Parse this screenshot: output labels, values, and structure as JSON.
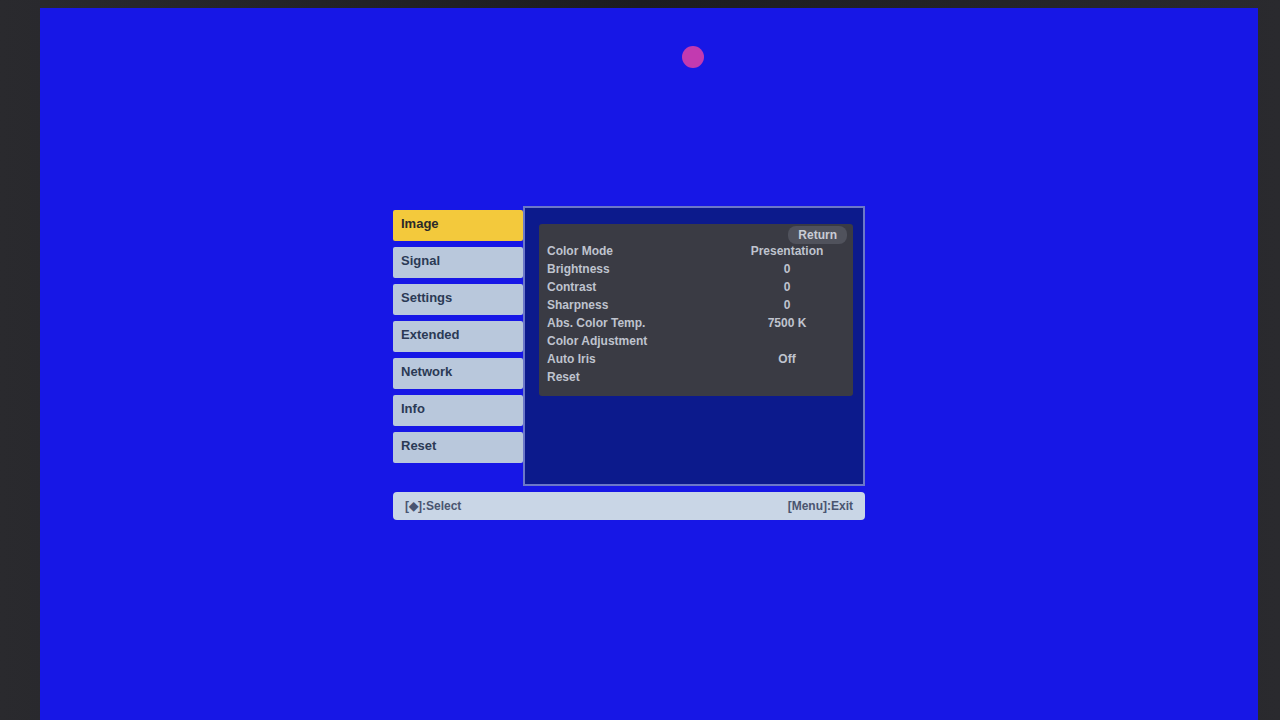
{
  "menu": {
    "tabs": [
      {
        "label": "Image",
        "selected": true
      },
      {
        "label": "Signal",
        "selected": false
      },
      {
        "label": "Settings",
        "selected": false
      },
      {
        "label": "Extended",
        "selected": false
      },
      {
        "label": "Network",
        "selected": false
      },
      {
        "label": "Info",
        "selected": false
      },
      {
        "label": "Reset",
        "selected": false
      }
    ],
    "return": "Return",
    "rows": [
      {
        "label": "Color Mode",
        "value": "Presentation"
      },
      {
        "label": "Brightness",
        "value": "0"
      },
      {
        "label": "Contrast",
        "value": "0"
      },
      {
        "label": "Sharpness",
        "value": "0"
      },
      {
        "label": "Abs. Color Temp.",
        "value": "7500 K"
      },
      {
        "label": "Color Adjustment"
      },
      {
        "label": "Auto Iris",
        "value": "Off"
      },
      {
        "label": "Reset"
      }
    ]
  },
  "footer": {
    "select": "[◆]:Select",
    "exit": "[Menu]:Exit"
  }
}
